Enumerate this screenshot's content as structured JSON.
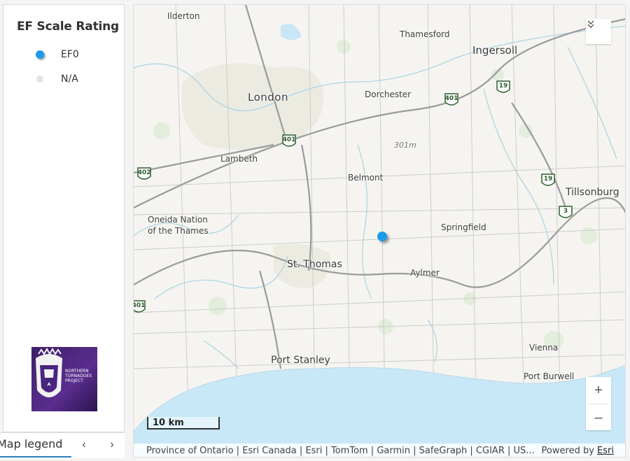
{
  "legend": {
    "title": "EF Scale Rating",
    "items": [
      {
        "label": "EF0",
        "color": "#1e9be8"
      },
      {
        "label": "N/A",
        "color": "#e3e3e3"
      }
    ],
    "logo_text": [
      "NORTHERN",
      "TORNADOES",
      "PROJECT"
    ]
  },
  "tabs": {
    "active_label": "Map legend",
    "prev_icon": "chevron-left-icon",
    "next_icon": "chevron-right-icon"
  },
  "map": {
    "places": [
      "Ilderton",
      "Thamesford",
      "Ingersoll",
      "London",
      "Dorchester",
      "Lambeth",
      "Belmont",
      "Tillsonburg",
      "Oneida Nation",
      "of the Thames",
      "Springfield",
      "St. Thomas",
      "Aylmer",
      "Vienna",
      "Port Stanley",
      "Port Burwell"
    ],
    "highways": [
      "401",
      "401",
      "19",
      "402",
      "19",
      "3",
      "401"
    ],
    "elevation_label": "301m",
    "scale_label": "10 km",
    "attribution": "Province of Ontario | Esri Canada | Esri | TomTom | Garmin | SafeGraph | CGIAR | US...",
    "powered_by": "Powered by",
    "powered_link": "Esri",
    "zoom_in": "+",
    "zoom_out": "–",
    "collapse_icon": "chevrons-down-icon"
  }
}
